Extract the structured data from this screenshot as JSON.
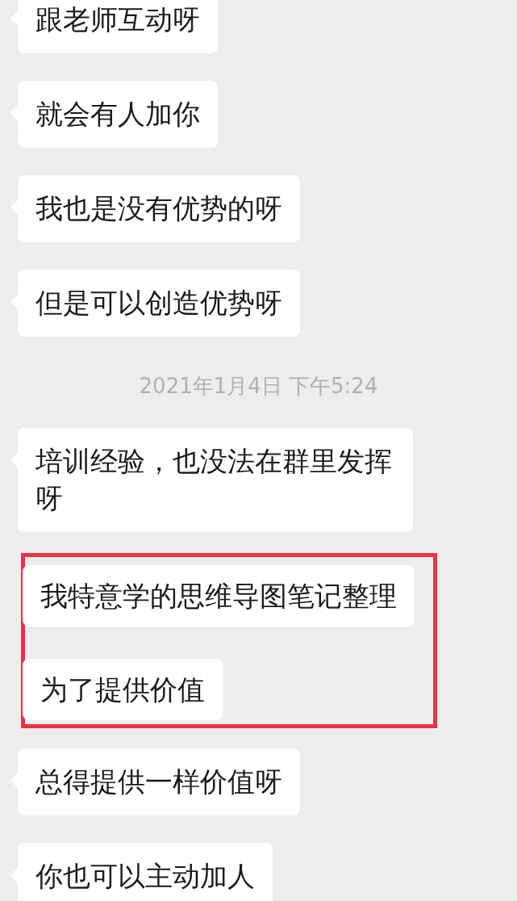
{
  "items": [
    {
      "kind": "message",
      "text": "跟老师互动呀"
    },
    {
      "kind": "message",
      "text": "就会有人加你"
    },
    {
      "kind": "message",
      "text": "我也是没有优势的呀"
    },
    {
      "kind": "message",
      "text": "但是可以创造优势呀"
    },
    {
      "kind": "timestamp",
      "text": "2021年1月4日 下午5:24"
    },
    {
      "kind": "message",
      "text": "培训经验，也没法在群里发挥呀"
    },
    {
      "kind": "highlight",
      "messages": [
        "我特意学的思维导图笔记整理",
        "为了提供价值"
      ]
    },
    {
      "kind": "message",
      "text": "总得提供一样价值呀"
    },
    {
      "kind": "message",
      "text": "你也可以主动加人"
    }
  ]
}
